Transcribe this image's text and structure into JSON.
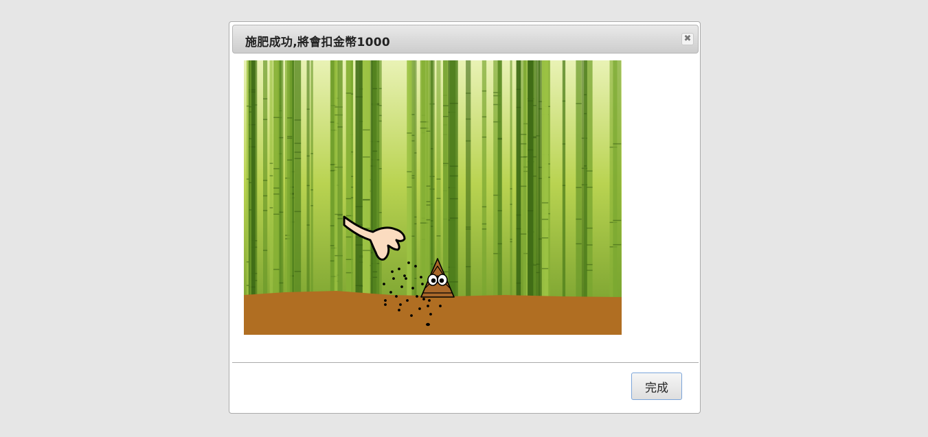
{
  "dialog": {
    "title": "施肥成功,將會扣金幣1000",
    "close_glyph": "✖",
    "close_icon": "close-icon",
    "done_label": "完成"
  },
  "scene": {
    "description_icons": [
      "bamboo-forest",
      "hand-icon",
      "fertilizer-pellets",
      "bamboo-shoot-character"
    ],
    "colors": {
      "soil": "#b06e22",
      "bamboo_light": "#c8dd5a",
      "bamboo_dark": "#4f7f1d",
      "skin": "#fbdcc0"
    }
  }
}
